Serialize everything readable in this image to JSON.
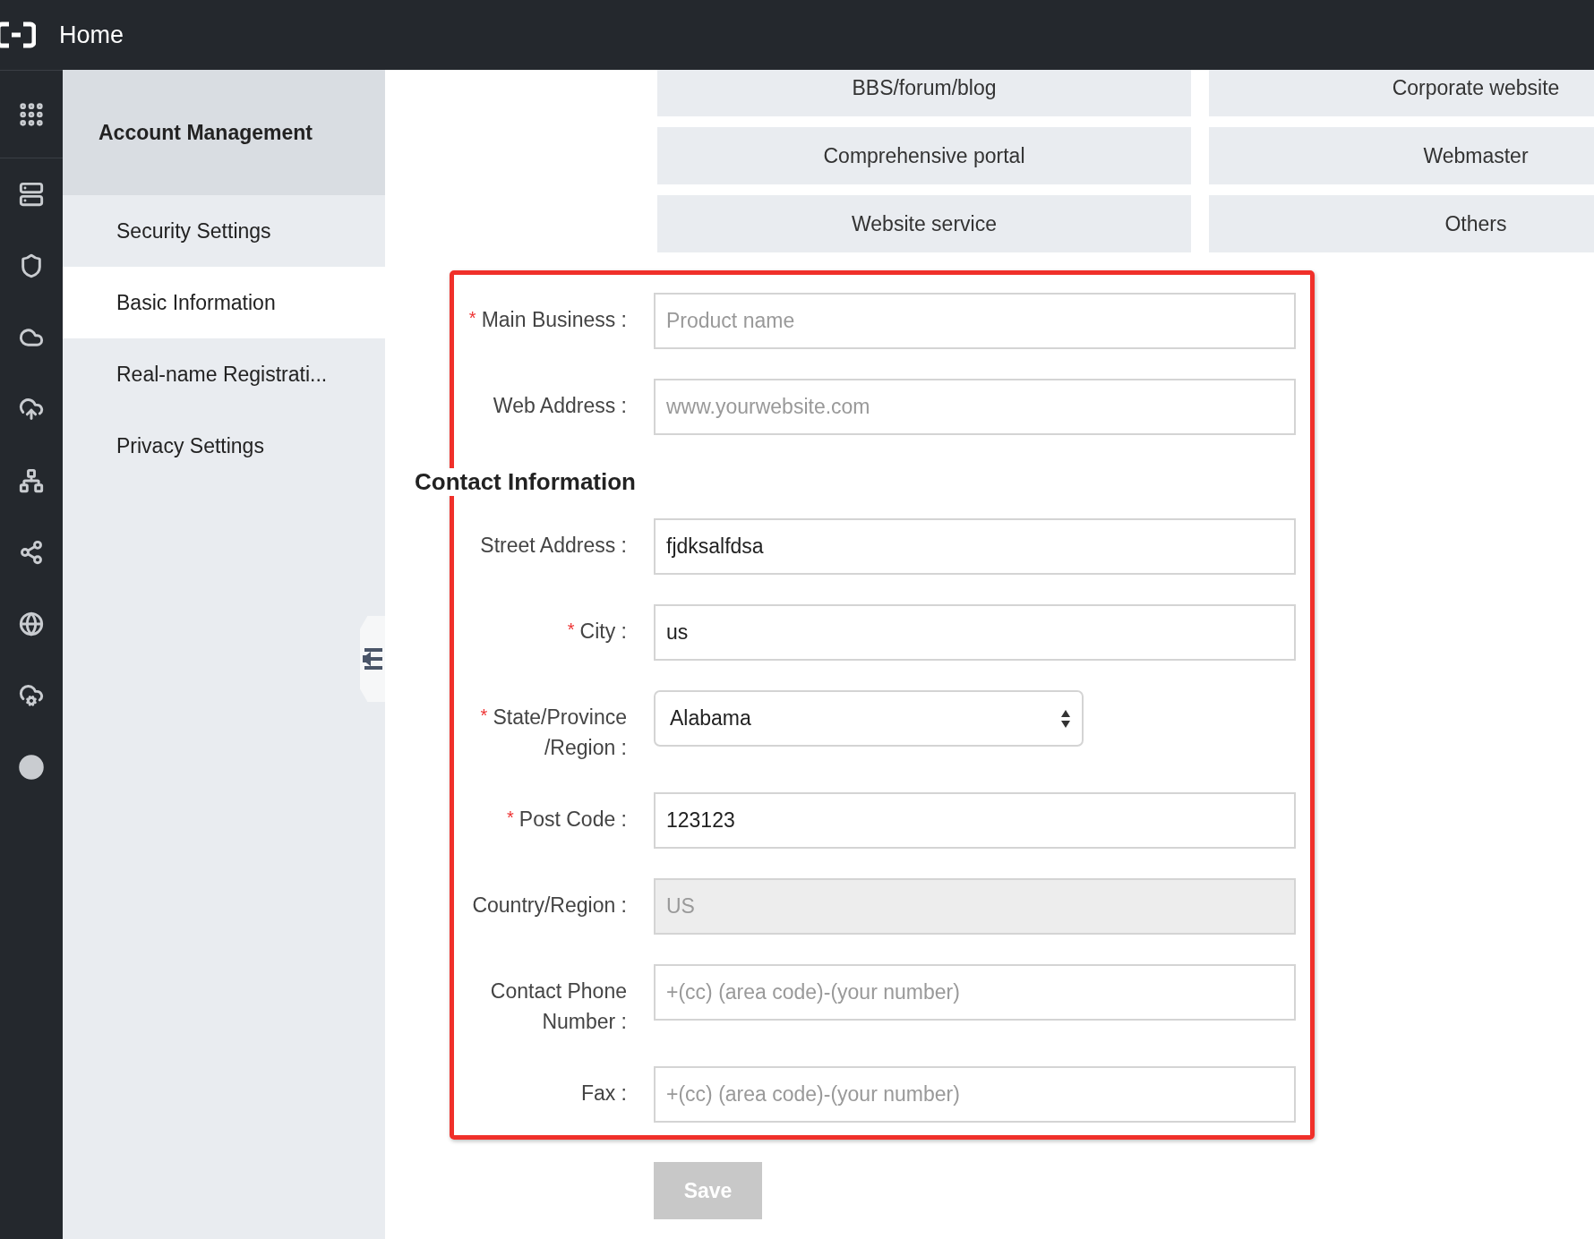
{
  "header": {
    "title": "Home"
  },
  "sidebar": {
    "title": "Account Management",
    "items": [
      {
        "label": "Security Settings",
        "selected": false
      },
      {
        "label": "Basic Information",
        "selected": true
      },
      {
        "label": "Real-name Registrati...",
        "selected": false
      },
      {
        "label": "Privacy Settings",
        "selected": false
      }
    ]
  },
  "categories": [
    "BBS/forum/blog",
    "Corporate website",
    "Comprehensive portal",
    "Webmaster",
    "Website service",
    "Others"
  ],
  "business_fields": [
    {
      "kind": "input",
      "label": "Main Business :",
      "required_mark": "*",
      "placeholder": "Product name",
      "disabled": false
    },
    {
      "kind": "input",
      "label": "Web Address :",
      "placeholder": "www.yourwebsite.com",
      "disabled": false
    }
  ],
  "contact_heading": "Contact Information",
  "contact_fields": [
    {
      "kind": "input",
      "label": "Street Address :",
      "value": "fjdksalfdsa",
      "disabled": false
    },
    {
      "kind": "input",
      "label": "City :",
      "required_mark": "*",
      "value": "us",
      "disabled": false
    },
    {
      "kind": "select",
      "label": "State/Province\n/Region :",
      "required_mark": "*",
      "value": "Alabama",
      "disabled": false
    },
    {
      "kind": "input",
      "label": "Post Code :",
      "required_mark": "*",
      "value": "123123",
      "disabled": false
    },
    {
      "kind": "input",
      "label": "Country/Region :",
      "value": "US",
      "disabled": true
    },
    {
      "kind": "input",
      "label": "Contact Phone\nNumber :",
      "placeholder": "+(cc) (area code)-(your number)",
      "disabled": false
    },
    {
      "kind": "input",
      "label": "Fax :",
      "placeholder": "+(cc) (area code)-(your number)",
      "disabled": false
    }
  ],
  "save": {
    "label": "Save",
    "disabled": true
  }
}
